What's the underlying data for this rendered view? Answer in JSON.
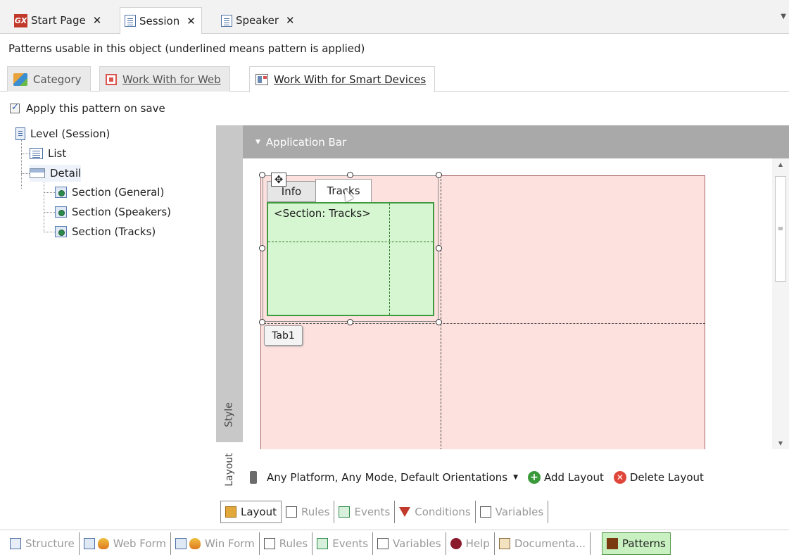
{
  "doc_tabs": [
    {
      "label": "Start Page",
      "icon": "gx-icon"
    },
    {
      "label": "Session",
      "icon": "document-icon",
      "active": true
    },
    {
      "label": "Speaker",
      "icon": "document-icon"
    }
  ],
  "patterns_caption": "Patterns usable in this object (underlined means pattern is applied)",
  "pattern_tabs": [
    {
      "label": "Category",
      "icon": "category-icon"
    },
    {
      "label": "Work With for Web",
      "icon": "web-pattern-icon",
      "applied": true
    },
    {
      "label": "Work With for Smart Devices",
      "icon": "smart-devices-icon",
      "applied": true,
      "active": true
    }
  ],
  "apply_on_save": {
    "label": "Apply this pattern on save",
    "checked": true
  },
  "tree": {
    "root": "Level (Session)",
    "list": "List",
    "detail": "Detail",
    "sections": [
      "Section (General)",
      "Section (Speakers)",
      "Section (Tracks)"
    ]
  },
  "vertical_tabs": {
    "style": "Style",
    "layout": "Layout",
    "active": "Layout"
  },
  "designer": {
    "application_bar": "Application Bar",
    "tab_control": {
      "tabs": [
        "Info",
        "Tracks"
      ],
      "selected": "Tracks",
      "section_label": "<Section: Tracks>",
      "name_badge": "Tab1"
    }
  },
  "layout_bar": {
    "platform": "Any Platform, Any Mode, Default Orientations",
    "add_layout": "Add Layout",
    "delete_layout": "Delete Layout"
  },
  "inner_toolbar": [
    "Layout",
    "Rules",
    "Events",
    "Conditions",
    "Variables"
  ],
  "bottom_toolbar": [
    "Structure",
    "Web Form",
    "Win Form",
    "Rules",
    "Events",
    "Variables",
    "Help",
    "Documenta...",
    "Patterns"
  ],
  "colors": {
    "accent_green": "#c8f0c0",
    "canvas_pink": "#fde1de",
    "section_green": "#d6f5d1",
    "app_bar_gray": "#a9a9a9"
  }
}
